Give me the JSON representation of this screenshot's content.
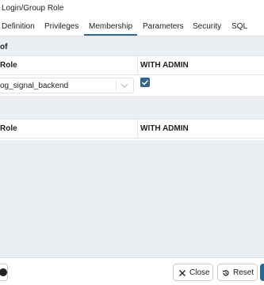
{
  "window": {
    "title": "Login/Group Role"
  },
  "tabs": [
    {
      "label": "Definition"
    },
    {
      "label": "Privileges"
    },
    {
      "label": "Membership"
    },
    {
      "label": "Parameters"
    },
    {
      "label": "Security"
    },
    {
      "label": "SQL"
    }
  ],
  "active_tab": "Membership",
  "member_of": {
    "section_label": "of",
    "columns": {
      "role": "Role",
      "admin": "WITH ADMIN"
    },
    "rows": [
      {
        "role": "og_signal_backend",
        "with_admin": true
      }
    ]
  },
  "members": {
    "columns": {
      "role": "Role",
      "admin": "WITH ADMIN"
    },
    "rows": []
  },
  "footer": {
    "close_label": "Close",
    "reset_label": "Reset"
  },
  "colors": {
    "accent": "#326690",
    "panel_bg": "#ebeef3",
    "border": "#dde0e6"
  }
}
